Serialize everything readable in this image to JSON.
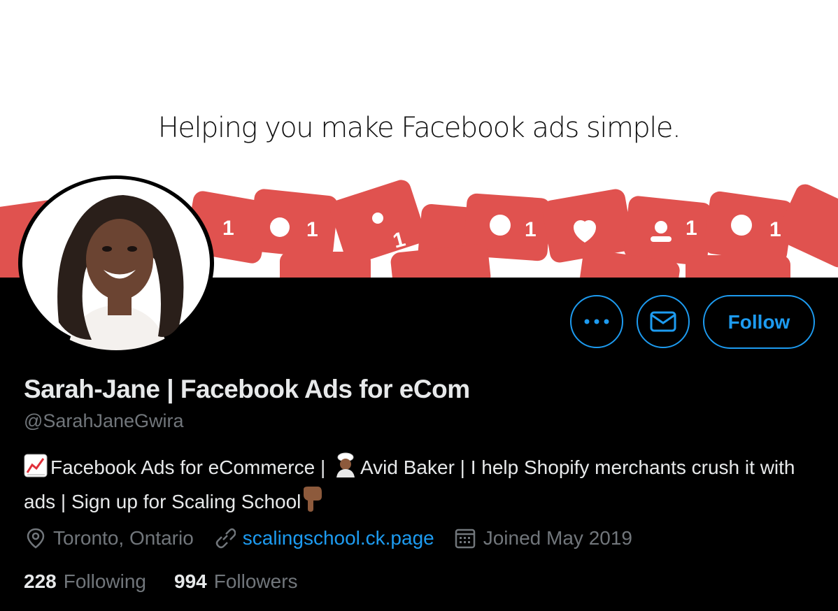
{
  "banner": {
    "tagline": "Helping you make Facebook ads simple."
  },
  "profile": {
    "name": "Sarah-Jane | Facebook Ads for eCom",
    "handle": "@SarahJaneGwira",
    "bio": {
      "part1": "Facebook Ads for eCommerce |",
      "part2": "Avid Baker | I help Shopify merchants crush it with ads | Sign up for Scaling School"
    },
    "location": "Toronto, Ontario",
    "website": "scalingschool.ck.page",
    "joined": "Joined May 2019",
    "following_count": "228",
    "following_label": "Following",
    "followers_count": "994",
    "followers_label": "Followers"
  },
  "actions": {
    "follow_label": "Follow"
  },
  "colors": {
    "accent": "#1d9bf0",
    "banner_red": "#e0524f",
    "background": "#000000",
    "muted": "#71767b"
  },
  "icons": [
    "more-icon",
    "mail-icon",
    "location-icon",
    "link-icon",
    "calendar-icon",
    "chart-emoji",
    "baker-emoji",
    "point-down-emoji"
  ]
}
